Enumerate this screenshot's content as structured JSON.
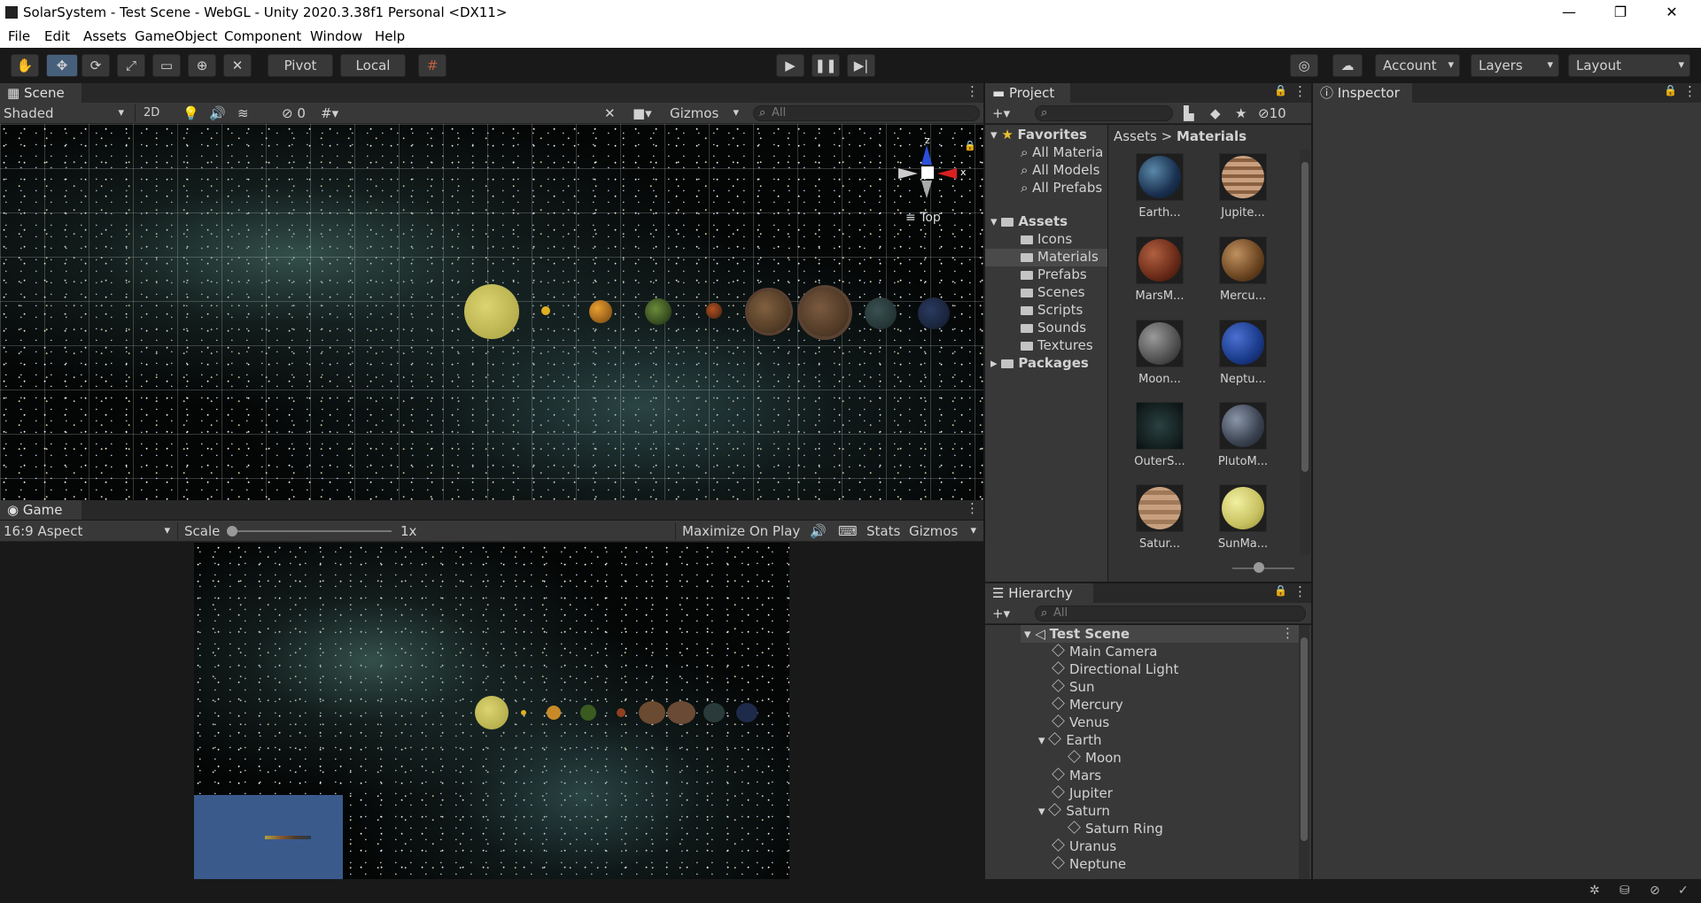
{
  "window": {
    "title": "SolarSystem - Test Scene - WebGL - Unity 2020.3.38f1 Personal <DX11>",
    "minimize": "—",
    "maximize": "❐",
    "close": "✕"
  },
  "menu": [
    "File",
    "Edit",
    "Assets",
    "GameObject",
    "Component",
    "Window",
    "Help"
  ],
  "toolbar": {
    "pivot": "Pivot",
    "local": "Local",
    "account": "Account",
    "layers": "Layers",
    "layout": "Layout"
  },
  "scene": {
    "tab": "Scene",
    "shading": "Shaded",
    "mode2d": "2D",
    "hidden_count": "0",
    "gizmos": "Gizmos",
    "search_placeholder": "All",
    "view_label": "Top",
    "axis_x": "x",
    "axis_z": "z"
  },
  "game": {
    "tab": "Game",
    "aspect": "16:9 Aspect",
    "scale_label": "Scale",
    "scale_value": "1x",
    "maximize": "Maximize On Play",
    "stats": "Stats",
    "gizmos": "Gizmos"
  },
  "project": {
    "tab": "Project",
    "hidden_count": "10",
    "favorites": {
      "label": "Favorites",
      "items": [
        "All Materia",
        "All Models",
        "All Prefabs"
      ]
    },
    "assets": {
      "label": "Assets",
      "folders": [
        "Icons",
        "Materials",
        "Prefabs",
        "Scenes",
        "Scripts",
        "Sounds",
        "Textures"
      ]
    },
    "packages": "Packages",
    "breadcrumb": {
      "root": "Assets",
      "sep": ">",
      "current": "Materials"
    },
    "materials": [
      "Earth...",
      "Jupite...",
      "MarsM...",
      "Mercu...",
      "Moon...",
      "Neptu...",
      "OuterS...",
      "PlutoM...",
      "Satur...",
      "SunMa..."
    ]
  },
  "inspector": {
    "tab": "Inspector"
  },
  "hierarchy": {
    "tab": "Hierarchy",
    "search_placeholder": "All",
    "scene_name": "Test Scene",
    "items": [
      "Main Camera",
      "Directional Light",
      "Sun",
      "Mercury",
      "Venus",
      "Earth",
      "Moon",
      "Mars",
      "Jupiter",
      "Saturn",
      "Saturn Ring",
      "Uranus",
      "Neptune"
    ]
  },
  "colors": {
    "accent": "#46607c",
    "panel": "#383838",
    "background": "#191919",
    "sun": "#c8c060",
    "selection": "#2c5d87"
  }
}
